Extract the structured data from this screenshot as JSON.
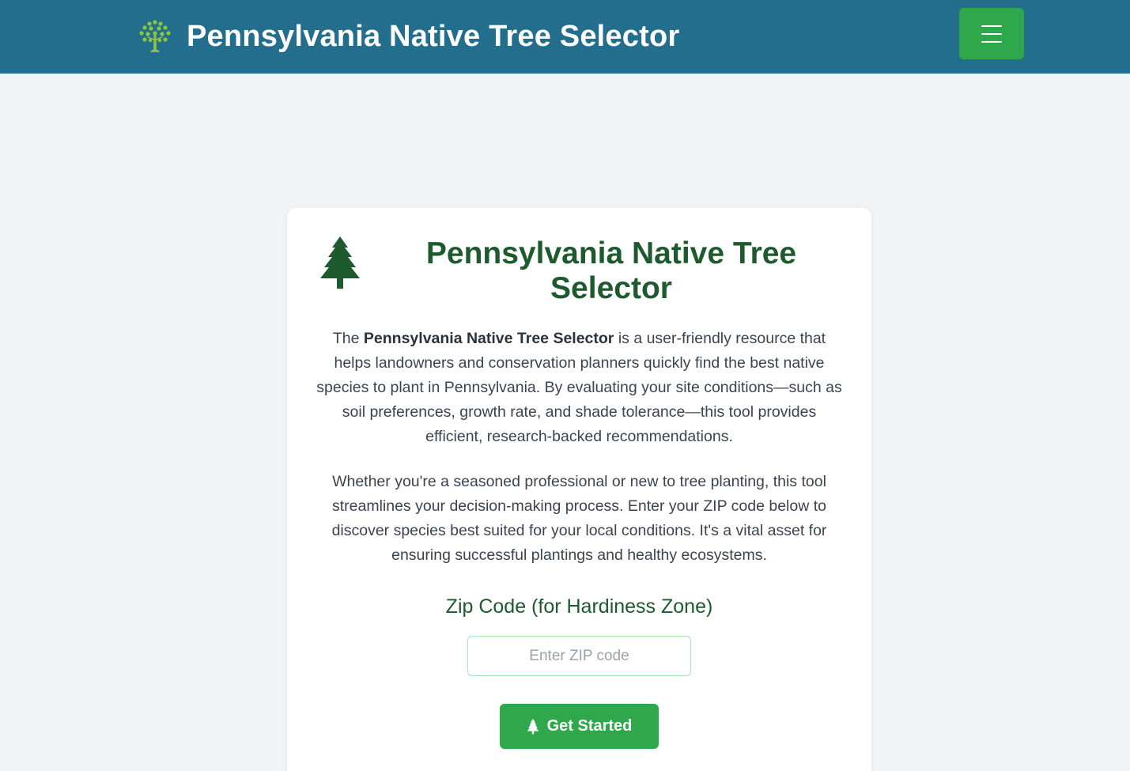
{
  "header": {
    "title": "Pennsylvania Native Tree Selector",
    "logo_icon": "tree-logo-icon",
    "menu_icon": "hamburger-menu-icon"
  },
  "card": {
    "icon": "pine-tree-icon",
    "title": "Pennsylvania Native Tree Selector",
    "intro": {
      "prefix": "The ",
      "bold": "Pennsylvania Native Tree Selector",
      "rest": " is a user-friendly resource that helps landowners and conservation planners quickly find the best native species to plant in Pennsylvania. By evaluating your site conditions—such as soil preferences, growth rate, and shade tolerance—this tool provides efficient, research-backed recommendations."
    },
    "paragraph2": "Whether you're a seasoned professional or new to tree planting, this tool streamlines your decision-making process. Enter your ZIP code below to discover species best suited for your local conditions. It's a vital asset for ensuring successful plantings and healthy ecosystems.",
    "zip_label": "Zip Code (for Hardiness Zone)",
    "zip_value": "",
    "zip_placeholder": "Enter ZIP code",
    "button_label": "Get Started"
  },
  "colors": {
    "header_bg": "#226e8c",
    "accent_green": "#2ea84a",
    "title_green": "#1d5a2e",
    "page_bg": "#f2f4f5"
  }
}
